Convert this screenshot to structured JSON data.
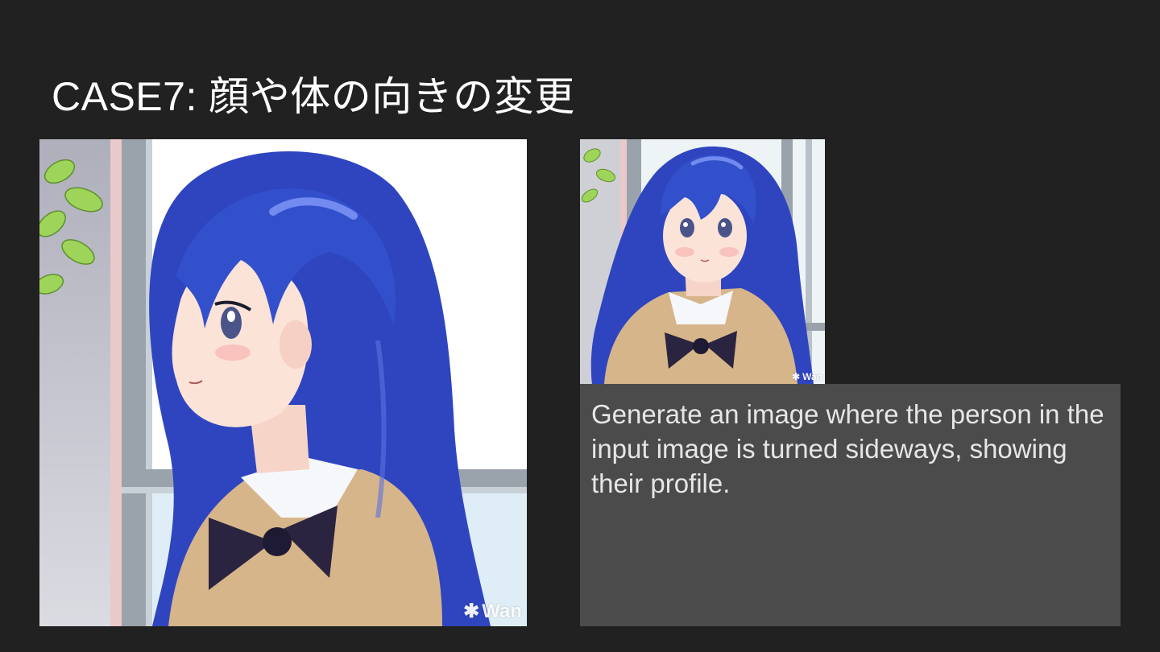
{
  "slide": {
    "title": "CASE7: 顔や体の向きの変更",
    "prompt_text": "Generate an image where the person in the input image is turned sideways, showing their profile.",
    "watermark_label": "Wan"
  },
  "images": {
    "output": {
      "subject": "anime-girl-profile-blue-hair"
    },
    "input": {
      "subject": "anime-girl-front-blue-hair"
    }
  },
  "colors": {
    "background": "#212121",
    "prompt_box": "#4b4b4b",
    "prompt_text": "#e6e6e6",
    "title_text": "#ffffff",
    "hair": "#2f45c0",
    "cardigan": "#d7b58a",
    "bow": "#2a2440"
  }
}
